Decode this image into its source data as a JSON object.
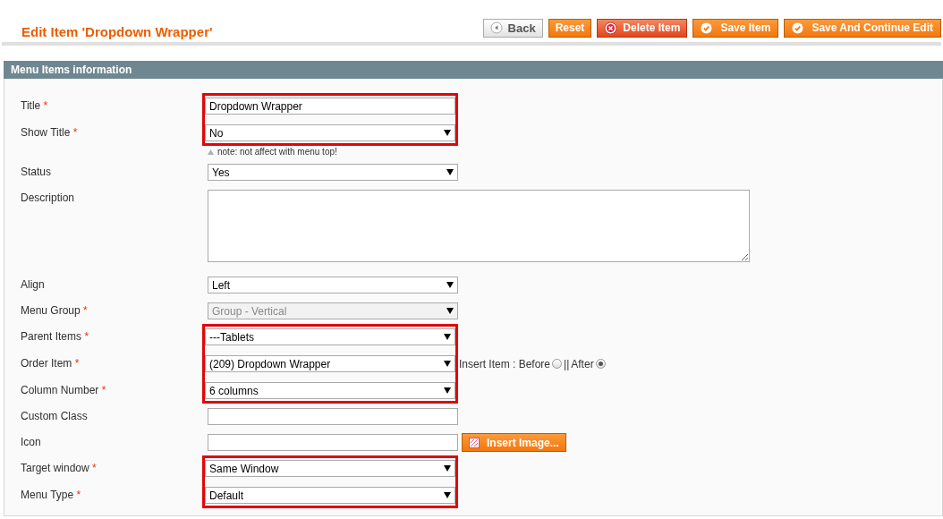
{
  "header": {
    "title": "Edit Item 'Dropdown Wrapper'",
    "buttons": [
      {
        "label": "Back",
        "kind": "back"
      },
      {
        "label": "Reset",
        "kind": "plain"
      },
      {
        "label": "Delete Item",
        "kind": "delete"
      },
      {
        "label": "Save Item",
        "kind": "save"
      },
      {
        "label": "Save And Continue Edit",
        "kind": "save"
      }
    ]
  },
  "section": {
    "title": "Menu Items information"
  },
  "fields": [
    {
      "label": "Title",
      "required_mark": "*",
      "kind": "input",
      "value": "Dropdown Wrapper",
      "highlighted": true,
      "disabled": false
    },
    {
      "label": "Show Title",
      "required_mark": "*",
      "kind": "select",
      "value": "No",
      "highlighted": true,
      "disabled": false,
      "note": "note: not affect with menu top!"
    },
    {
      "label": "Status",
      "kind": "select",
      "value": "Yes",
      "highlighted": false,
      "disabled": false
    },
    {
      "label": "Description",
      "kind": "textarea",
      "highlighted": false,
      "disabled": false
    },
    {
      "label": "Align",
      "kind": "select",
      "value": "Left",
      "highlighted": false,
      "disabled": false
    },
    {
      "label": "Menu Group",
      "required_mark": "*",
      "kind": "select",
      "value": "Group - Vertical",
      "highlighted": false,
      "disabled": true
    },
    {
      "label": "Parent Items",
      "required_mark": "*",
      "kind": "select",
      "value": "---Tablets",
      "highlighted": true,
      "disabled": false
    },
    {
      "label": "Order Item",
      "required_mark": "*",
      "kind": "select",
      "value": "(209) Dropdown Wrapper",
      "highlighted": true,
      "disabled": false,
      "extra": {
        "label": "Insert Item : Before",
        "separator": "||",
        "options": [
          {
            "selected": false
          },
          {
            "label": "After",
            "selected": true
          }
        ]
      }
    },
    {
      "label": "Column Number",
      "required_mark": "*",
      "kind": "select",
      "value": "6 columns",
      "highlighted": true,
      "disabled": false
    },
    {
      "label": "Custom Class",
      "kind": "input",
      "highlighted": false,
      "disabled": false
    },
    {
      "label": "Icon",
      "kind": "input",
      "highlighted": false,
      "disabled": false,
      "button": "Insert Image..."
    },
    {
      "label": "Target window",
      "required_mark": "*",
      "kind": "select",
      "value": "Same Window",
      "highlighted": true,
      "disabled": false
    },
    {
      "label": "Menu Type",
      "required_mark": "*",
      "kind": "select",
      "value": "Default",
      "highlighted": true,
      "disabled": false
    }
  ]
}
